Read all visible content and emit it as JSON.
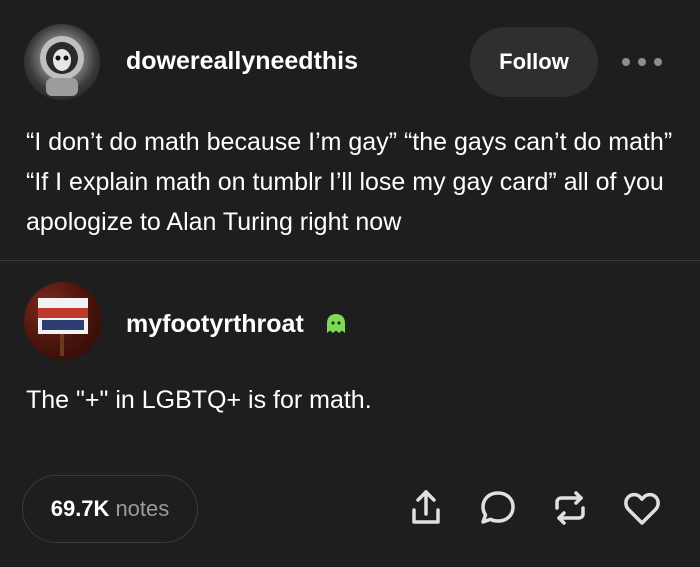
{
  "post": {
    "username": "dowereallyneedthis",
    "follow_label": "Follow",
    "text": "“I don’t do math because I’m gay” “the gays can’t do math” “If I explain math on tumblr I’ll lose my gay card” all of you apologize to Alan Turing right now"
  },
  "reply": {
    "username": "myfootyrthroat",
    "text": "The \"+\" in LGBTQ+ is for math."
  },
  "footer": {
    "notes_count": "69.7K",
    "notes_label": "notes"
  },
  "icons": {
    "more": "more-icon",
    "badge": "ghost-icon",
    "share": "share-icon",
    "reply": "reply-icon",
    "reblog": "reblog-icon",
    "like": "heart-icon"
  },
  "colors": {
    "background": "#1e1e1e",
    "text": "#ffffff",
    "muted": "#9a9a9a",
    "button_bg": "#2f2f2f"
  }
}
